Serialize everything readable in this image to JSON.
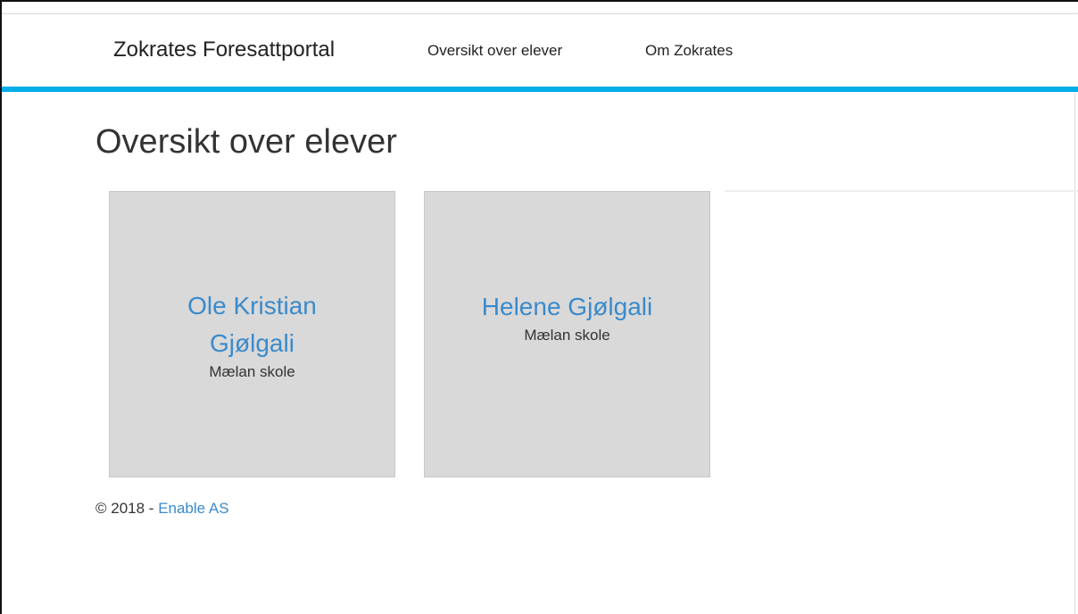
{
  "navbar": {
    "brand": "Zokrates Foresattportal",
    "links": [
      {
        "label": "Oversikt over elever"
      },
      {
        "label": "Om Zokrates"
      }
    ],
    "accent_color": "#00aee6"
  },
  "main": {
    "title": "Oversikt over elever",
    "students": [
      {
        "name": "Ole Kristian Gjølgali",
        "school": "Mælan skole"
      },
      {
        "name": "Helene Gjølgali",
        "school": "Mælan skole"
      }
    ],
    "link_color": "#3a8acb",
    "card_color": "#d9d9d9"
  },
  "footer": {
    "copyright": "© 2018 - ",
    "company": "Enable AS"
  }
}
